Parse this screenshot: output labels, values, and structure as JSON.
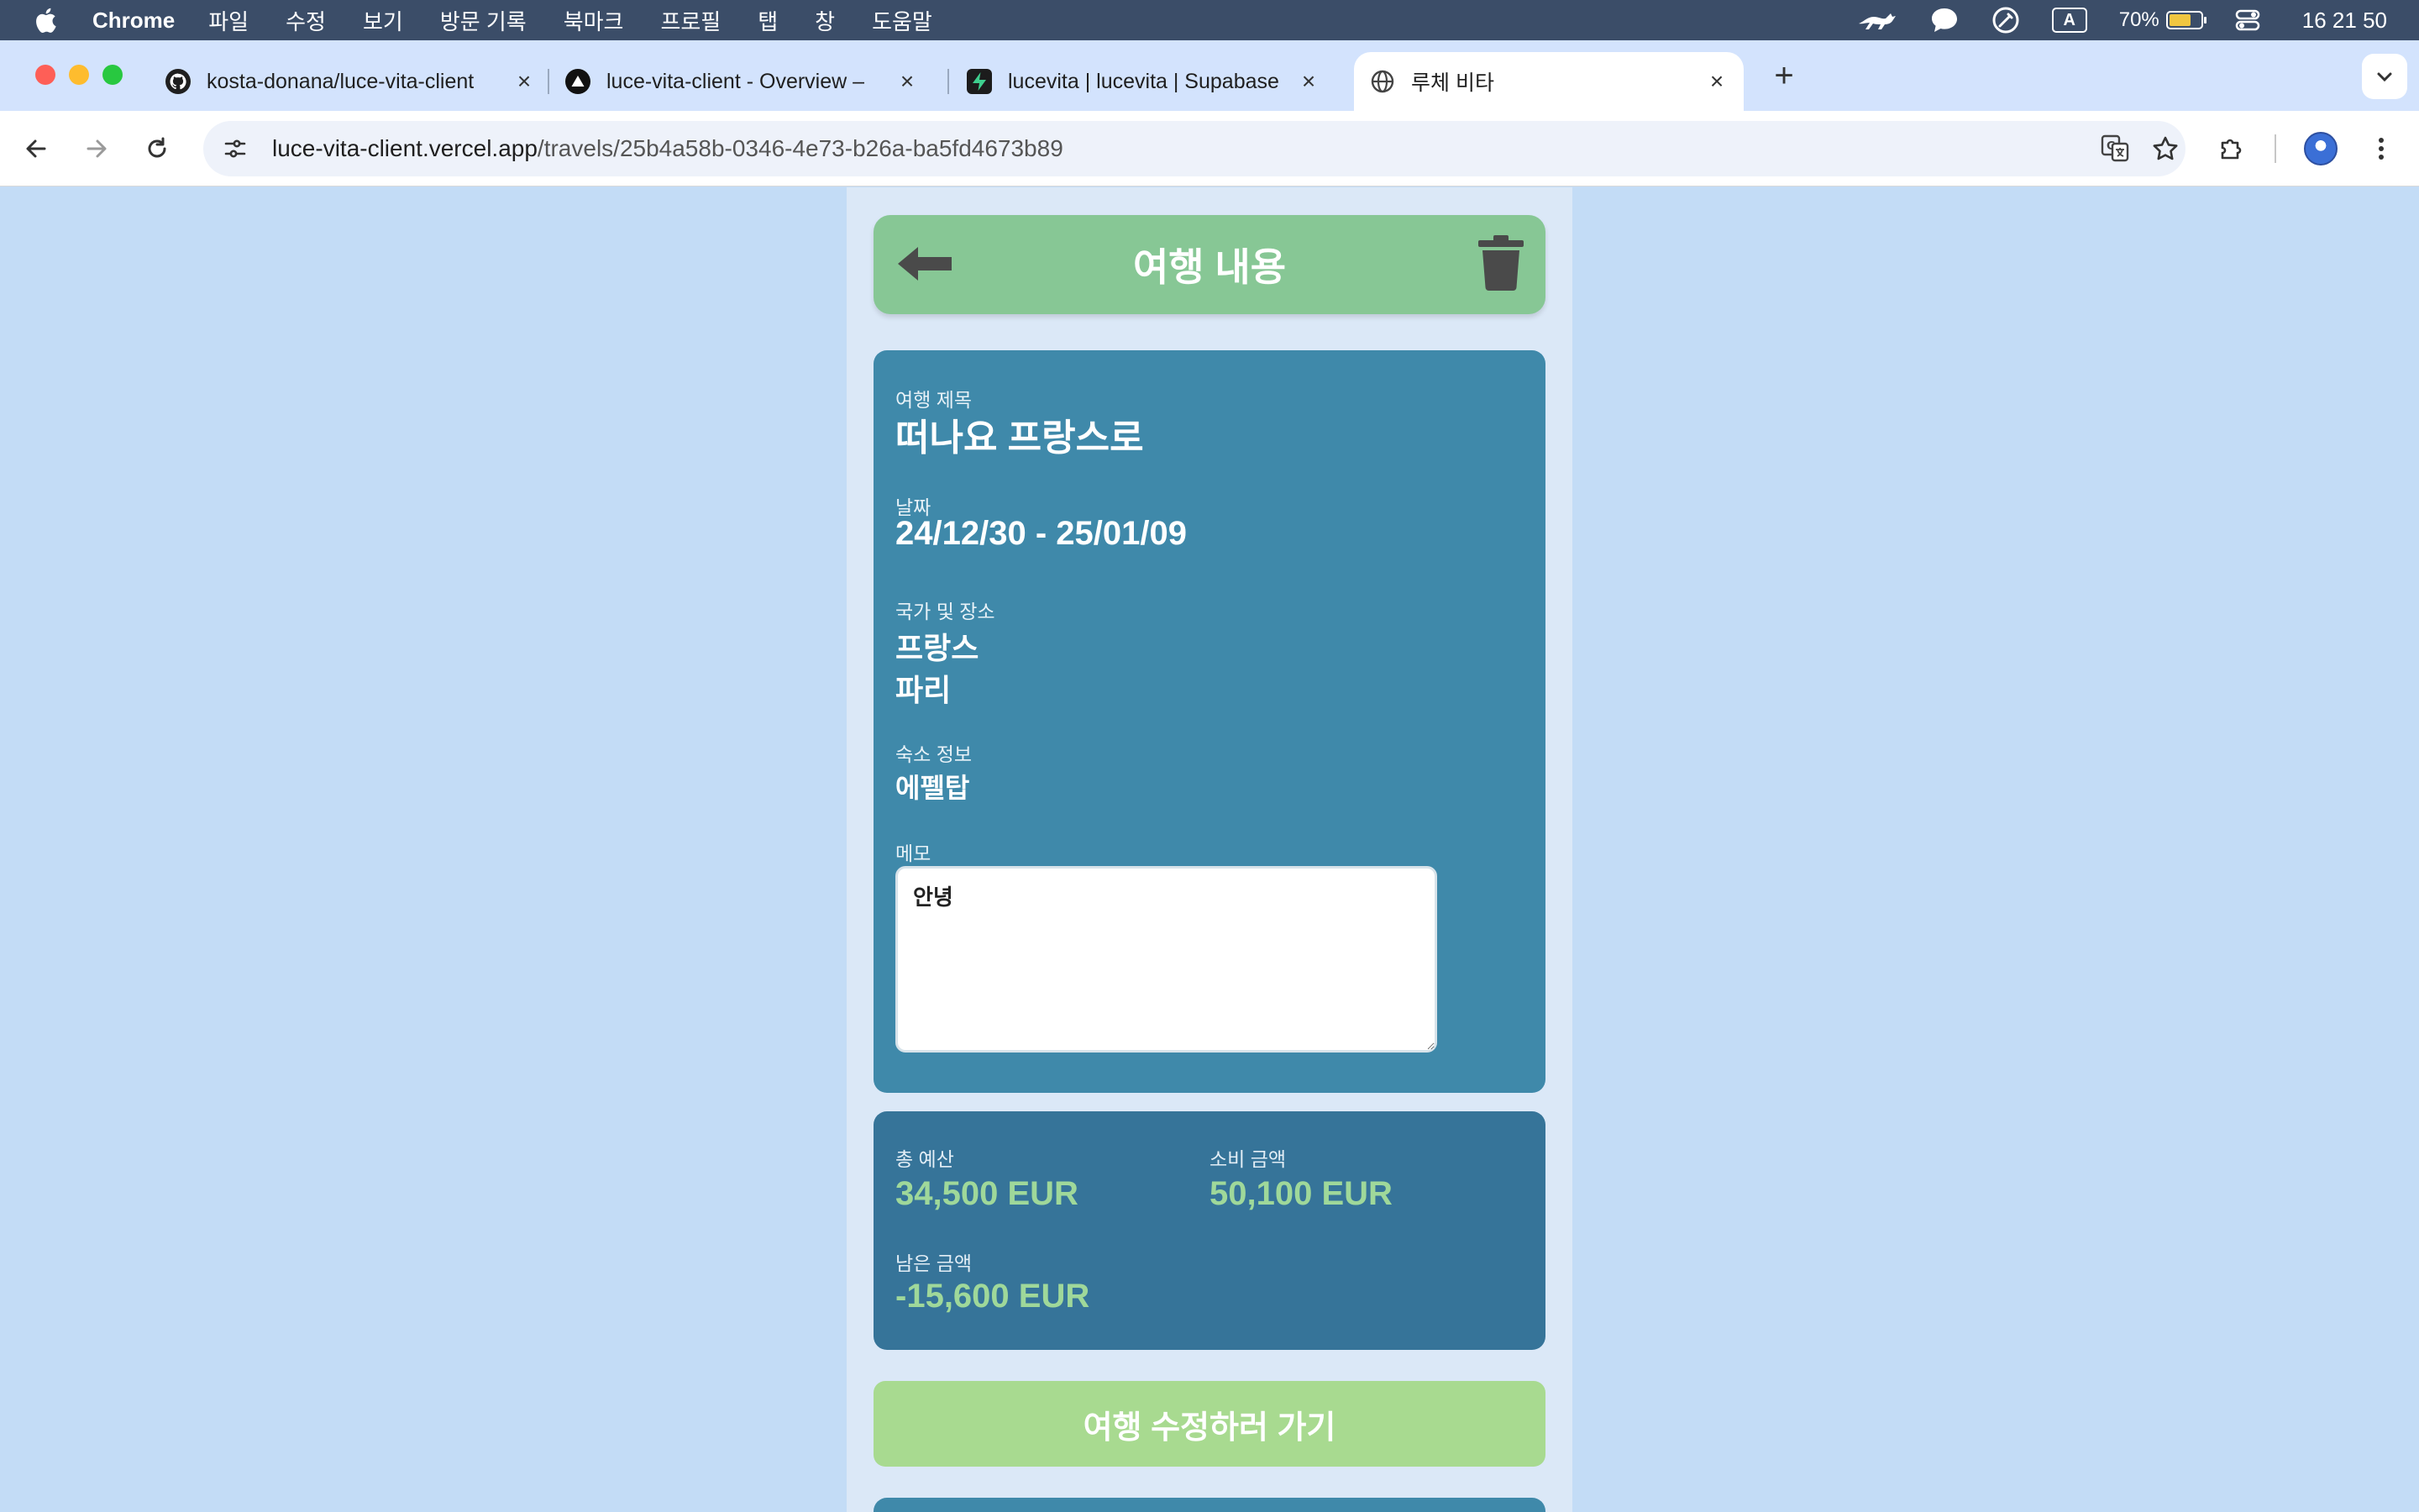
{
  "menubar": {
    "app_name": "Chrome",
    "items": [
      "파일",
      "수정",
      "보기",
      "방문 기록",
      "북마크",
      "프로필",
      "탭",
      "창",
      "도움말"
    ],
    "battery_percent": "70%",
    "battery_level": 0.7,
    "input_indicator": "A",
    "clock": "16 21 50"
  },
  "tabs": [
    {
      "title": "kosta-donana/luce-vita-client",
      "icon": "github-icon"
    },
    {
      "title": "luce-vita-client - Overview –",
      "icon": "vercel-icon"
    },
    {
      "title": "lucevita | lucevita | Supabase",
      "icon": "supabase-icon"
    },
    {
      "title": "루체 비타",
      "icon": "globe-icon",
      "active": true
    }
  ],
  "address": {
    "host": "luce-vita-client.vercel.app",
    "path": "/travels/25b4a58b-0346-4e73-b26a-ba5fd4673b89"
  },
  "page": {
    "header_title": "여행 내용",
    "title_label": "여행 제목",
    "title_value": "떠나요 프랑스로",
    "date_label": "날짜",
    "date_value": "24/12/30 - 25/01/09",
    "place_label": "국가 및 장소",
    "country_value": "프랑스",
    "city_value": "파리",
    "lodging_label": "숙소 정보",
    "lodging_value": "에펠탑",
    "memo_label": "메모",
    "memo_value": "안녕",
    "budget": {
      "total_label": "총 예산",
      "total_value": "34,500 EUR",
      "spent_label": "소비 금액",
      "spent_value": "50,100 EUR",
      "remaining_label": "남은 금액",
      "remaining_value": "-15,600 EUR"
    },
    "edit_button_label": "여행 수정하러 가기"
  },
  "colors": {
    "header_green": "#87c795",
    "info_card_blue": "#3f89aa",
    "budget_card_blue": "#367499",
    "budget_value_green": "#9fd89a",
    "edit_button_green": "#a8da90",
    "page_background": "#c3dcf6"
  }
}
